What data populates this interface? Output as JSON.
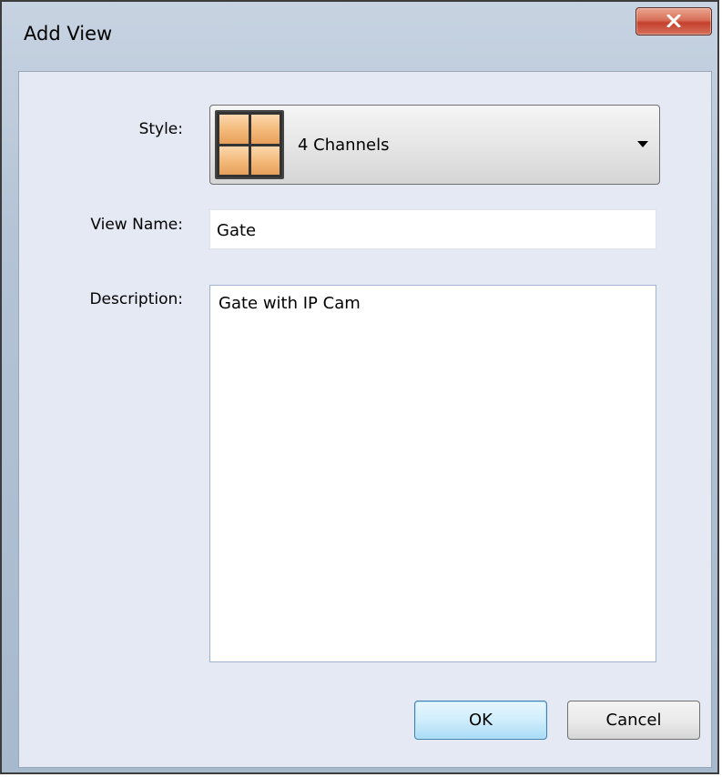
{
  "window": {
    "title": "Add View",
    "close_icon": "close-x-icon"
  },
  "form": {
    "style_label": "Style:",
    "style_value": "4 Channels",
    "style_icon": "four-channel-grid-icon",
    "view_name_label": "View Name:",
    "view_name_value": "Gate",
    "description_label": "Description:",
    "description_value": "Gate with IP Cam"
  },
  "buttons": {
    "ok_label": "OK",
    "cancel_label": "Cancel"
  },
  "colors": {
    "client_bg": "#e4e9f3",
    "close_button": "#c4412e",
    "default_button_border": "#3c7fb1"
  }
}
